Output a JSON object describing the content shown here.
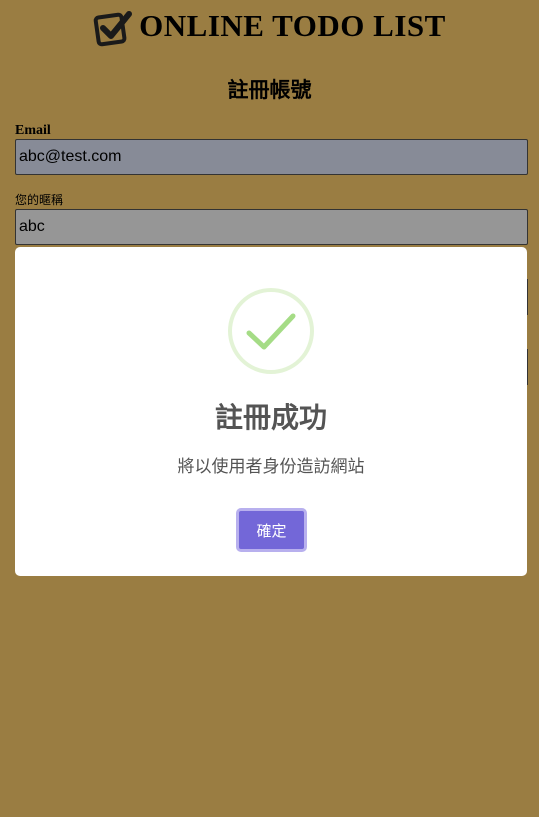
{
  "header": {
    "title": "ONLINE TODO LIST",
    "logo_icon": "checkbox-check-icon"
  },
  "form": {
    "heading": "註冊帳號",
    "email_label": "Email",
    "email_value": "abc@test.com",
    "nickname_label": "您的暱稱",
    "nickname_value": "abc"
  },
  "modal": {
    "icon": "success-check-icon",
    "title": "註冊成功",
    "text": "將以使用者身份造訪網站",
    "confirm_label": "確定"
  },
  "colors": {
    "page_background": "#9a7d42",
    "confirm_button": "#7367d8",
    "success_green": "#a5dc86"
  }
}
